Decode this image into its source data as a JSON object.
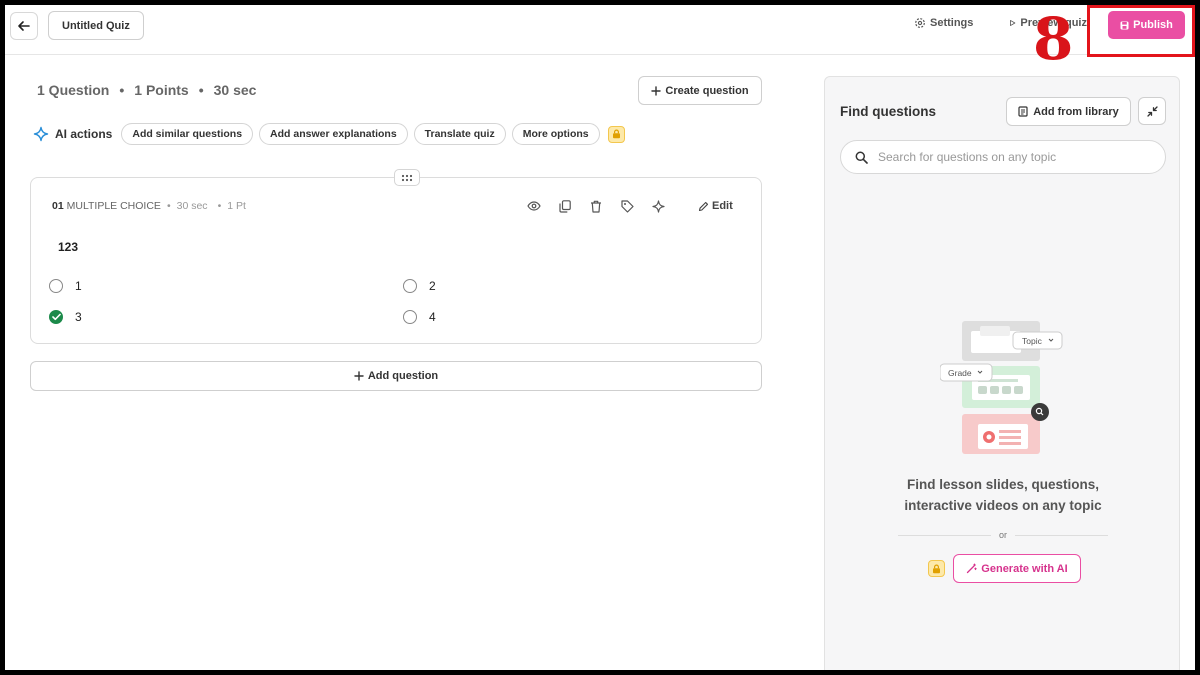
{
  "header": {
    "quiz_title": "Untitled Quiz",
    "settings_label": "Settings",
    "preview_label": "Preview quiz",
    "publish_label": "Publish",
    "step_number": "8"
  },
  "stats": {
    "questions": "1 Question",
    "points": "1 Points",
    "time": "30 sec",
    "separator": "•"
  },
  "create_question_label": "Create question",
  "ai_actions": {
    "label": "AI actions",
    "chips": [
      "Add similar questions",
      "Add answer explanations",
      "Translate quiz",
      "More options"
    ]
  },
  "question": {
    "number": "01",
    "type": "MULTIPLE CHOICE",
    "time": "30 sec",
    "points": "1 Pt",
    "separator": "•",
    "edit_label": "Edit",
    "text": "123",
    "options": [
      {
        "label": "1",
        "correct": false
      },
      {
        "label": "2",
        "correct": false
      },
      {
        "label": "3",
        "correct": true
      },
      {
        "label": "4",
        "correct": false
      }
    ]
  },
  "add_question_label": "Add question",
  "panel": {
    "title": "Find questions",
    "library_label": "Add from library",
    "search_placeholder": "Search for questions on any topic",
    "illus_topic": "Topic",
    "illus_grade": "Grade",
    "find_text_line1": "Find lesson slides, questions,",
    "find_text_line2": "interactive videos on any topic",
    "or_label": "or",
    "generate_label": "Generate with AI"
  },
  "colors": {
    "accent": "#ea4ea3",
    "correct": "#1c8a4a",
    "highlight": "#e3141b"
  }
}
